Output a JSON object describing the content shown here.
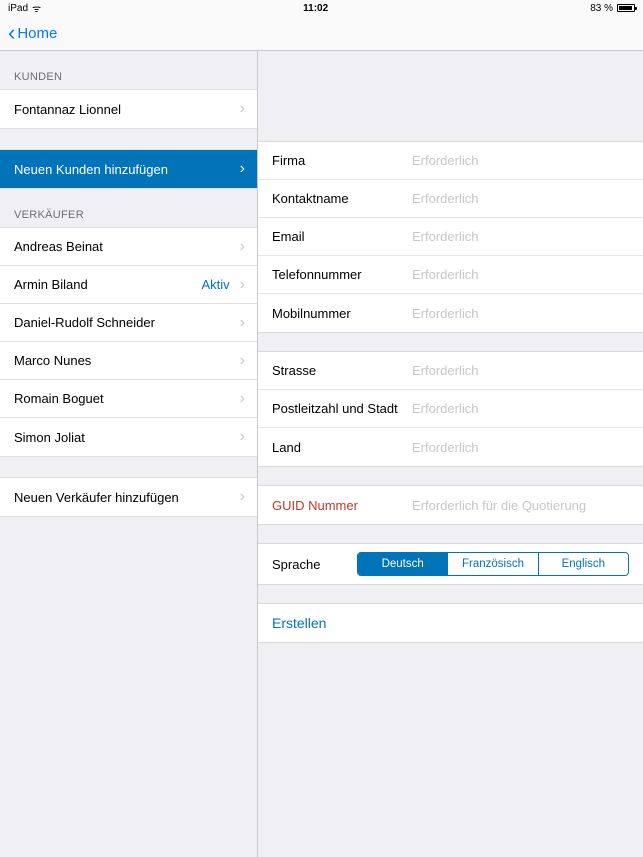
{
  "status": {
    "device": "iPad",
    "time": "11:02",
    "battery": "83 %"
  },
  "nav": {
    "back_label": "Home"
  },
  "sidebar": {
    "sections": {
      "kunden": {
        "header": "KUNDEN",
        "items": [
          {
            "label": "Fontannaz Lionnel"
          }
        ],
        "add_label": "Neuen Kunden hinzufügen"
      },
      "verkaufer": {
        "header": "VERKÄUFER",
        "items": [
          {
            "label": "Andreas Beinat",
            "status": ""
          },
          {
            "label": "Armin Biland",
            "status": "Aktiv"
          },
          {
            "label": "Daniel-Rudolf Schneider",
            "status": ""
          },
          {
            "label": "Marco Nunes",
            "status": ""
          },
          {
            "label": "Romain Boguet",
            "status": ""
          },
          {
            "label": "Simon Joliat",
            "status": ""
          }
        ],
        "add_label": "Neuen Verkäufer hinzufügen"
      }
    }
  },
  "form": {
    "group1": [
      {
        "label": "Firma",
        "placeholder": "Erforderlich"
      },
      {
        "label": "Kontaktname",
        "placeholder": "Erforderlich"
      },
      {
        "label": "Email",
        "placeholder": "Erforderlich"
      },
      {
        "label": "Telefonnummer",
        "placeholder": "Erforderlich"
      },
      {
        "label": "Mobilnummer",
        "placeholder": "Erforderlich"
      }
    ],
    "group2": [
      {
        "label": "Strasse",
        "placeholder": "Erforderlich"
      },
      {
        "label": "Postleitzahl und Stadt",
        "placeholder": "Erforderlich"
      },
      {
        "label": "Land",
        "placeholder": "Erforderlich"
      }
    ],
    "group3": {
      "label": "GUID Nummer",
      "placeholder": "Erforderlich für die Quotierung"
    },
    "language": {
      "label": "Sprache",
      "options": [
        "Deutsch",
        "Französisch",
        "Englisch"
      ],
      "selected": 0
    },
    "submit": "Erstellen"
  }
}
